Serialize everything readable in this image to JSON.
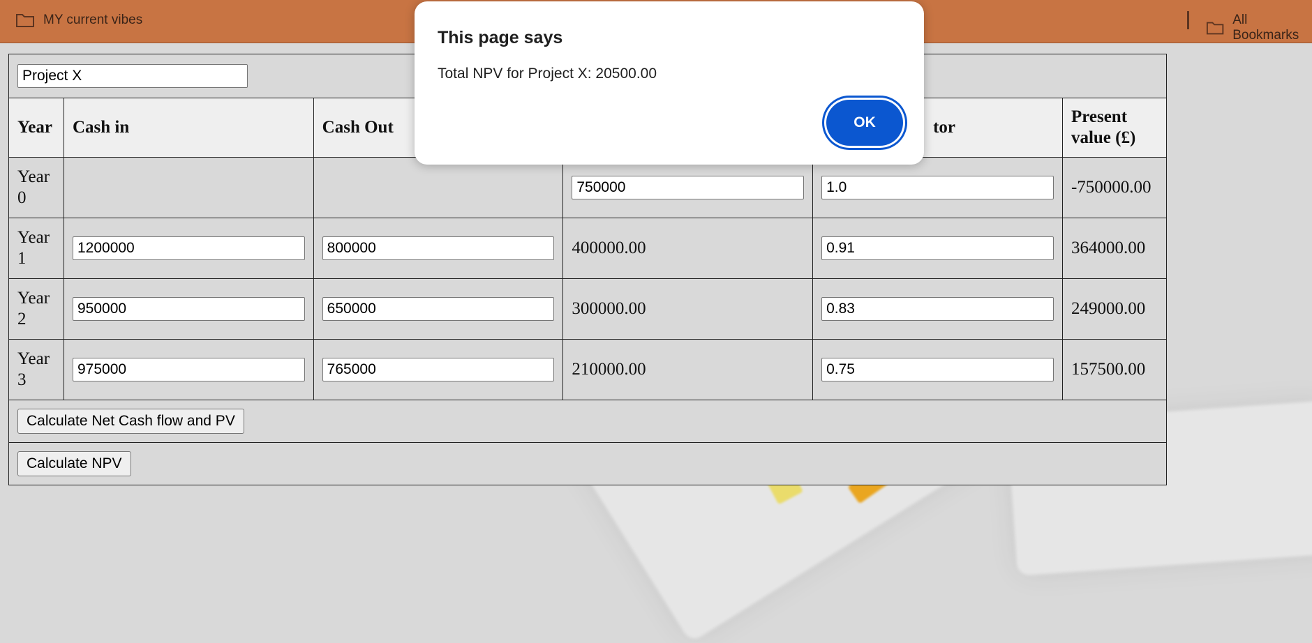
{
  "bookmarks_bar": {
    "items": [
      {
        "label": "MY current vibes",
        "icon": "folder-icon"
      },
      {
        "label": "All Bookmarks",
        "icon": "folder-icon"
      }
    ]
  },
  "project": {
    "name_value": "Project X"
  },
  "table": {
    "headers": {
      "year": "Year",
      "cash_in": "Cash in",
      "cash_out": "Cash Out",
      "factor_partial": "tor",
      "present_value": "Present value (£)"
    },
    "rows": [
      {
        "year": "Year 0",
        "cash_in": "",
        "cash_out": "",
        "net": "750000",
        "factor": "1.0",
        "pv": "-750000.00"
      },
      {
        "year": "Year 1",
        "cash_in": "1200000",
        "cash_out": "800000",
        "net": "400000.00",
        "factor": "0.91",
        "pv": "364000.00"
      },
      {
        "year": "Year 2",
        "cash_in": "950000",
        "cash_out": "650000",
        "net": "300000.00",
        "factor": "0.83",
        "pv": "249000.00"
      },
      {
        "year": "Year 3",
        "cash_in": "975000",
        "cash_out": "765000",
        "net": "210000.00",
        "factor": "0.75",
        "pv": "157500.00"
      }
    ]
  },
  "buttons": {
    "calc_net_pv": "Calculate Net Cash flow and PV",
    "calc_npv": "Calculate NPV"
  },
  "dialog": {
    "title": "This page says",
    "message": "Total NPV for Project X: 20500.00",
    "ok_label": "OK"
  },
  "colors": {
    "bookmarks_bar": "#c87443",
    "dialog_button": "#0b57d0",
    "page_background": "#d9d9d9"
  }
}
